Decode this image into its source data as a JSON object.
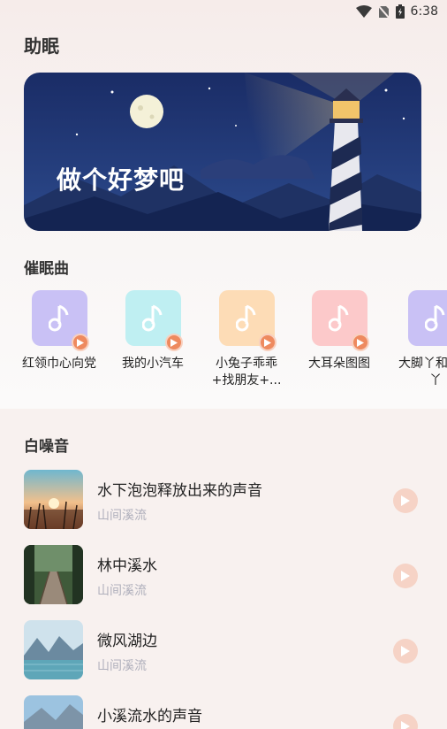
{
  "status_bar": {
    "time": "6:38"
  },
  "page": {
    "title": "助眠"
  },
  "banner": {
    "text": "做个好梦吧"
  },
  "lullabies": {
    "title": "催眠曲",
    "items": [
      {
        "label": "红领巾心向党",
        "color": "#c9c1f5"
      },
      {
        "label": "我的小汽车",
        "color": "#bfeff2"
      },
      {
        "label": "小兔子乖乖+找朋友+...",
        "color": "#fddcb6"
      },
      {
        "label": "大耳朵图图",
        "color": "#fcc9ca"
      },
      {
        "label": "大脚丫和小脚丫",
        "color": "#c9c1f5"
      }
    ]
  },
  "white_noise": {
    "title": "白噪音",
    "items": [
      {
        "title": "水下泡泡释放出来的声音",
        "subtitle": "山间溪流"
      },
      {
        "title": "林中溪水",
        "subtitle": "山间溪流"
      },
      {
        "title": "微风湖边",
        "subtitle": "山间溪流"
      },
      {
        "title": "小溪流水的声音",
        "subtitle": ""
      }
    ]
  },
  "colors": {
    "accent": "#ee8a5f",
    "play_circle": "#f6d3c6"
  }
}
